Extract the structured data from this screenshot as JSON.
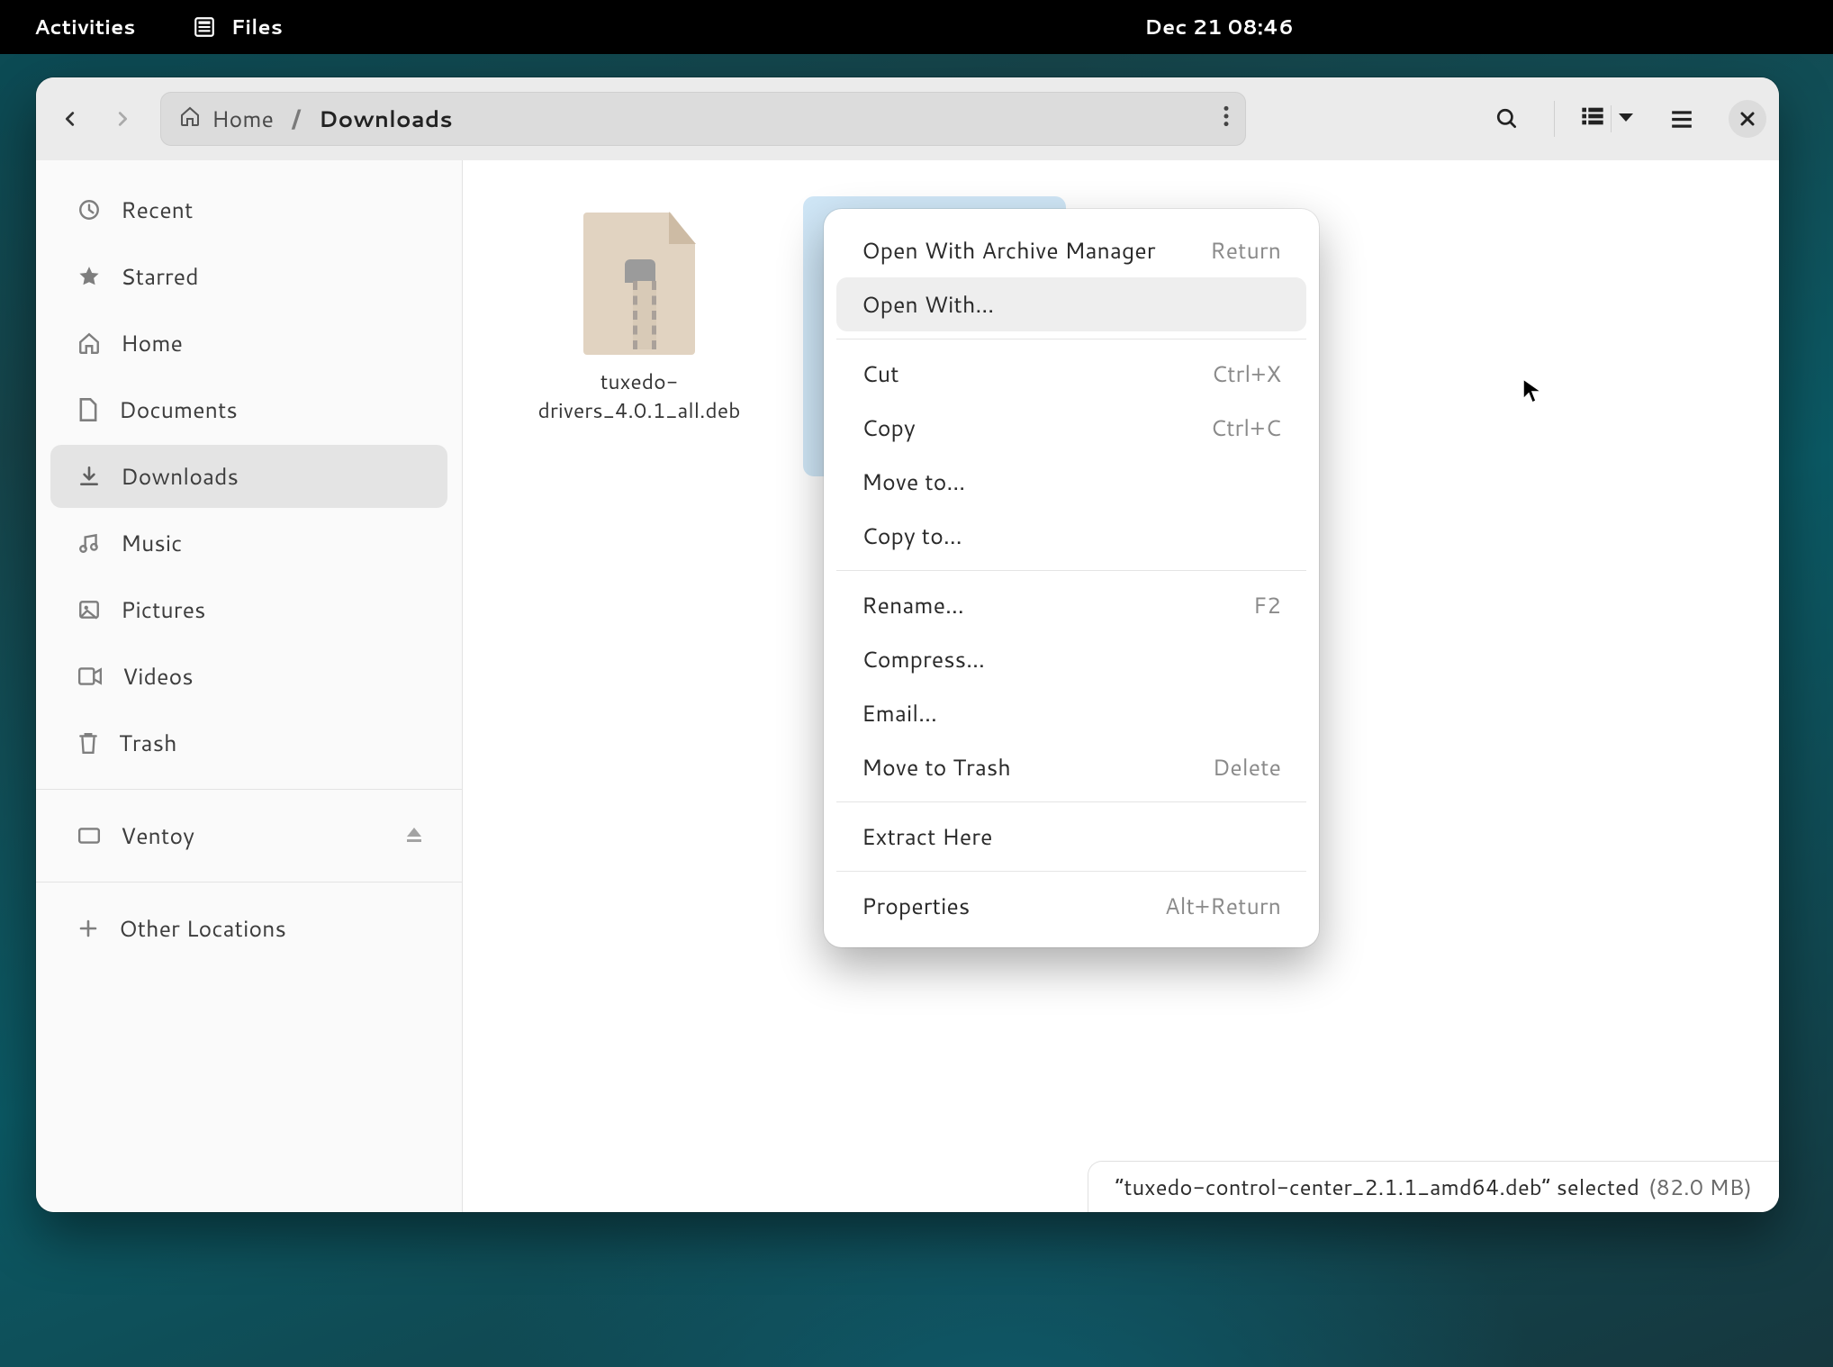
{
  "panel": {
    "activities": "Activities",
    "app": "Files",
    "clock": "Dec 21  08:46"
  },
  "path": {
    "home": "Home",
    "current": "Downloads"
  },
  "sidebar": {
    "recent": "Recent",
    "starred": "Starred",
    "home": "Home",
    "documents": "Documents",
    "downloads": "Downloads",
    "music": "Music",
    "pictures": "Pictures",
    "videos": "Videos",
    "trash": "Trash",
    "ventoy": "Ventoy",
    "other": "Other Locations"
  },
  "files": [
    {
      "name": "tuxedo-drivers_4.0.1_all.deb",
      "selected": false
    },
    {
      "name": "tuxedo-control-center_2.1.1_amd64.deb",
      "selected": true
    }
  ],
  "status": {
    "text": "“tuxedo-control-center_2.1.1_amd64.deb” selected",
    "size": "(82.0 MB)"
  },
  "menu": {
    "open_archive": "Open With Archive Manager",
    "open_archive_sc": "Return",
    "open_with": "Open With…",
    "cut": "Cut",
    "cut_sc": "Ctrl+X",
    "copy": "Copy",
    "copy_sc": "Ctrl+C",
    "move_to": "Move to…",
    "copy_to": "Copy to…",
    "rename": "Rename…",
    "rename_sc": "F2",
    "compress": "Compress…",
    "email": "Email…",
    "trash": "Move to Trash",
    "trash_sc": "Delete",
    "extract": "Extract Here",
    "properties": "Properties",
    "properties_sc": "Alt+Return"
  }
}
